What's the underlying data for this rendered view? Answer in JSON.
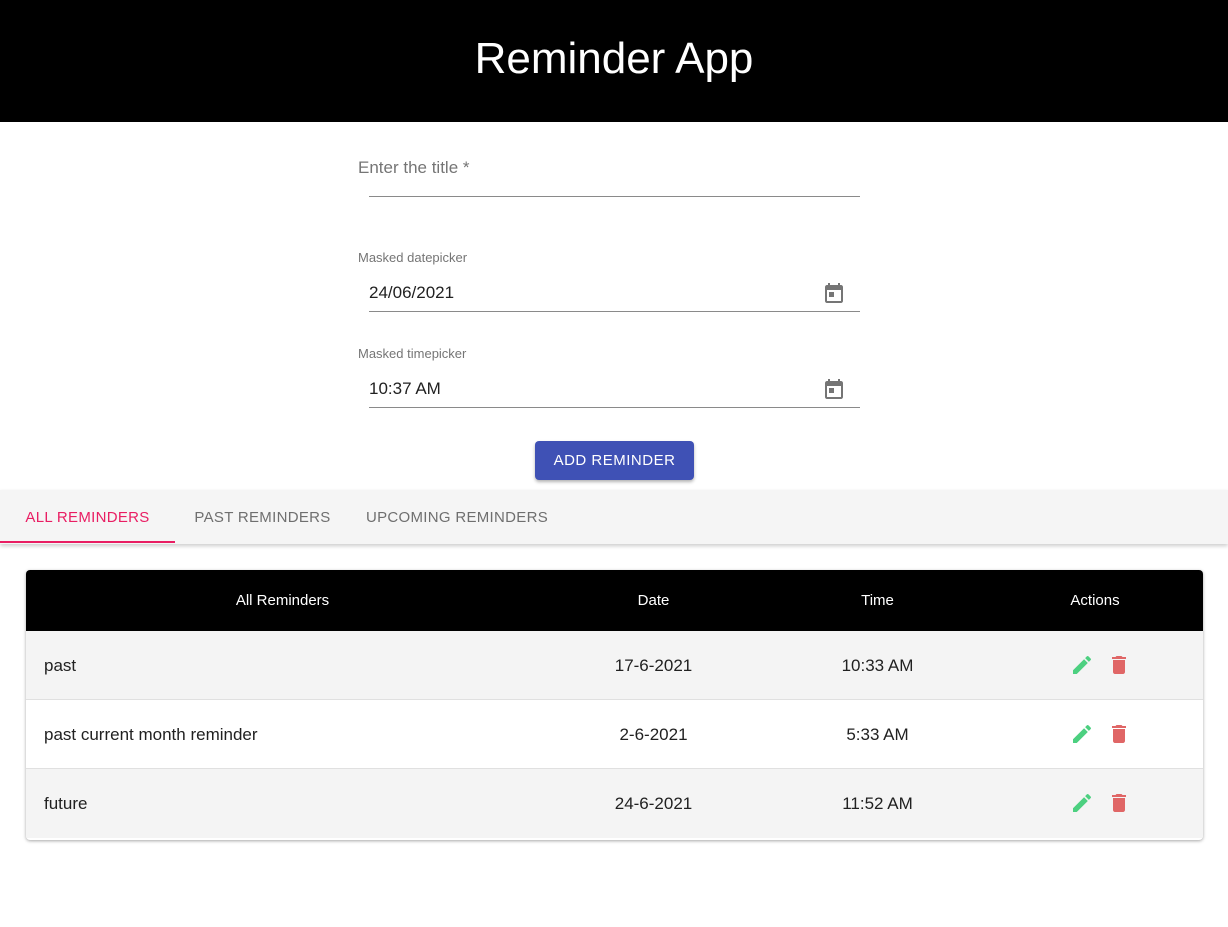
{
  "header": {
    "title": "Reminder App"
  },
  "form": {
    "title_field": {
      "label": "Enter the title *",
      "value": ""
    },
    "date_field": {
      "label": "Masked datepicker",
      "value": "24/06/2021",
      "icon": "calendar-icon"
    },
    "time_field": {
      "label": "Masked timepicker",
      "value": "10:37 AM",
      "icon": "calendar-icon"
    },
    "add_button": "ADD REMINDER"
  },
  "tabs": [
    {
      "label": "ALL REMINDERS",
      "active": true
    },
    {
      "label": "PAST REMINDERS",
      "active": false
    },
    {
      "label": "UPCOMING REMINDERS",
      "active": false
    }
  ],
  "table": {
    "headers": [
      "All Reminders",
      "Date",
      "Time",
      "Actions"
    ],
    "rows": [
      {
        "title": "past",
        "date": "17-6-2021",
        "time": "10:33 AM"
      },
      {
        "title": "past current month reminder",
        "date": "2-6-2021",
        "time": "5:33 AM"
      },
      {
        "title": "future",
        "date": "24-6-2021",
        "time": "11:52 AM"
      }
    ],
    "action_icons": [
      "edit-icon",
      "delete-icon"
    ]
  },
  "colors": {
    "header_bg": "#000000",
    "primary_button": "#3f51b5",
    "active_tab": "#e91e63",
    "edit_icon": "#4cd080",
    "delete_icon": "#e06666"
  }
}
